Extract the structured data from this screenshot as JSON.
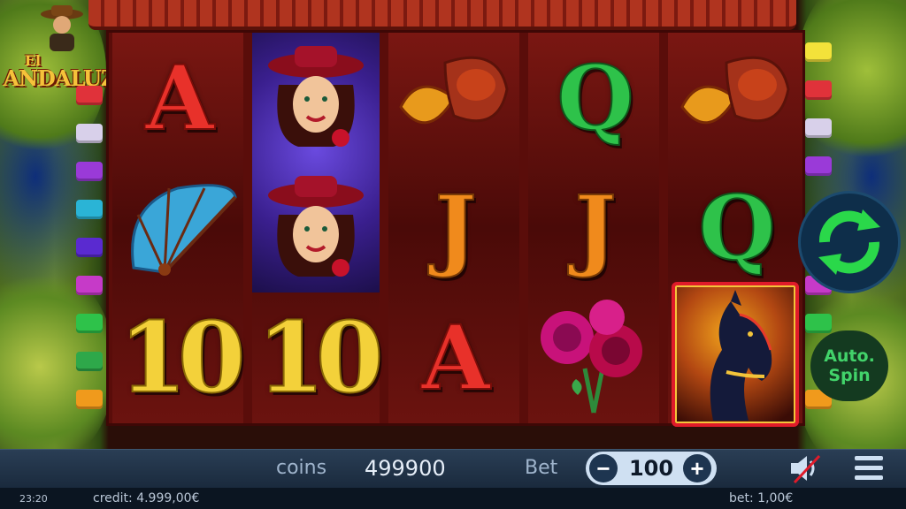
{
  "game": {
    "logo_line1": "El",
    "logo_line2": "ANDALUZ"
  },
  "reels": [
    [
      "A",
      "fan-symbol",
      "10"
    ],
    [
      "lady-symbol",
      "lady-symbol",
      "10"
    ],
    [
      "sombrero-symbol",
      "J",
      "A"
    ],
    [
      "Q",
      "J",
      "roses-symbol"
    ],
    [
      "sombrero-symbol",
      "Q",
      "horse-symbol"
    ]
  ],
  "controls": {
    "spin_icon": "refresh-icon",
    "auto_spin_label_line1": "Auto.",
    "auto_spin_label_line2": "Spin"
  },
  "bottom_bar": {
    "coins_label": "coins",
    "coins_value": "499900",
    "bet_label": "Bet",
    "bet_value": "100",
    "minus_label": "−",
    "plus_label": "+",
    "sound_icon": "speaker-muted-icon",
    "menu_icon": "hamburger-menu-icon"
  },
  "status_bar": {
    "time": "23:20",
    "credit": "credit: 4.999,00€",
    "bet": "bet: 1,00€"
  },
  "colors": {
    "accent_green": "#42d36a",
    "bet_pill": "#cfe0f2",
    "bar_bg": "#1a2a3d"
  }
}
